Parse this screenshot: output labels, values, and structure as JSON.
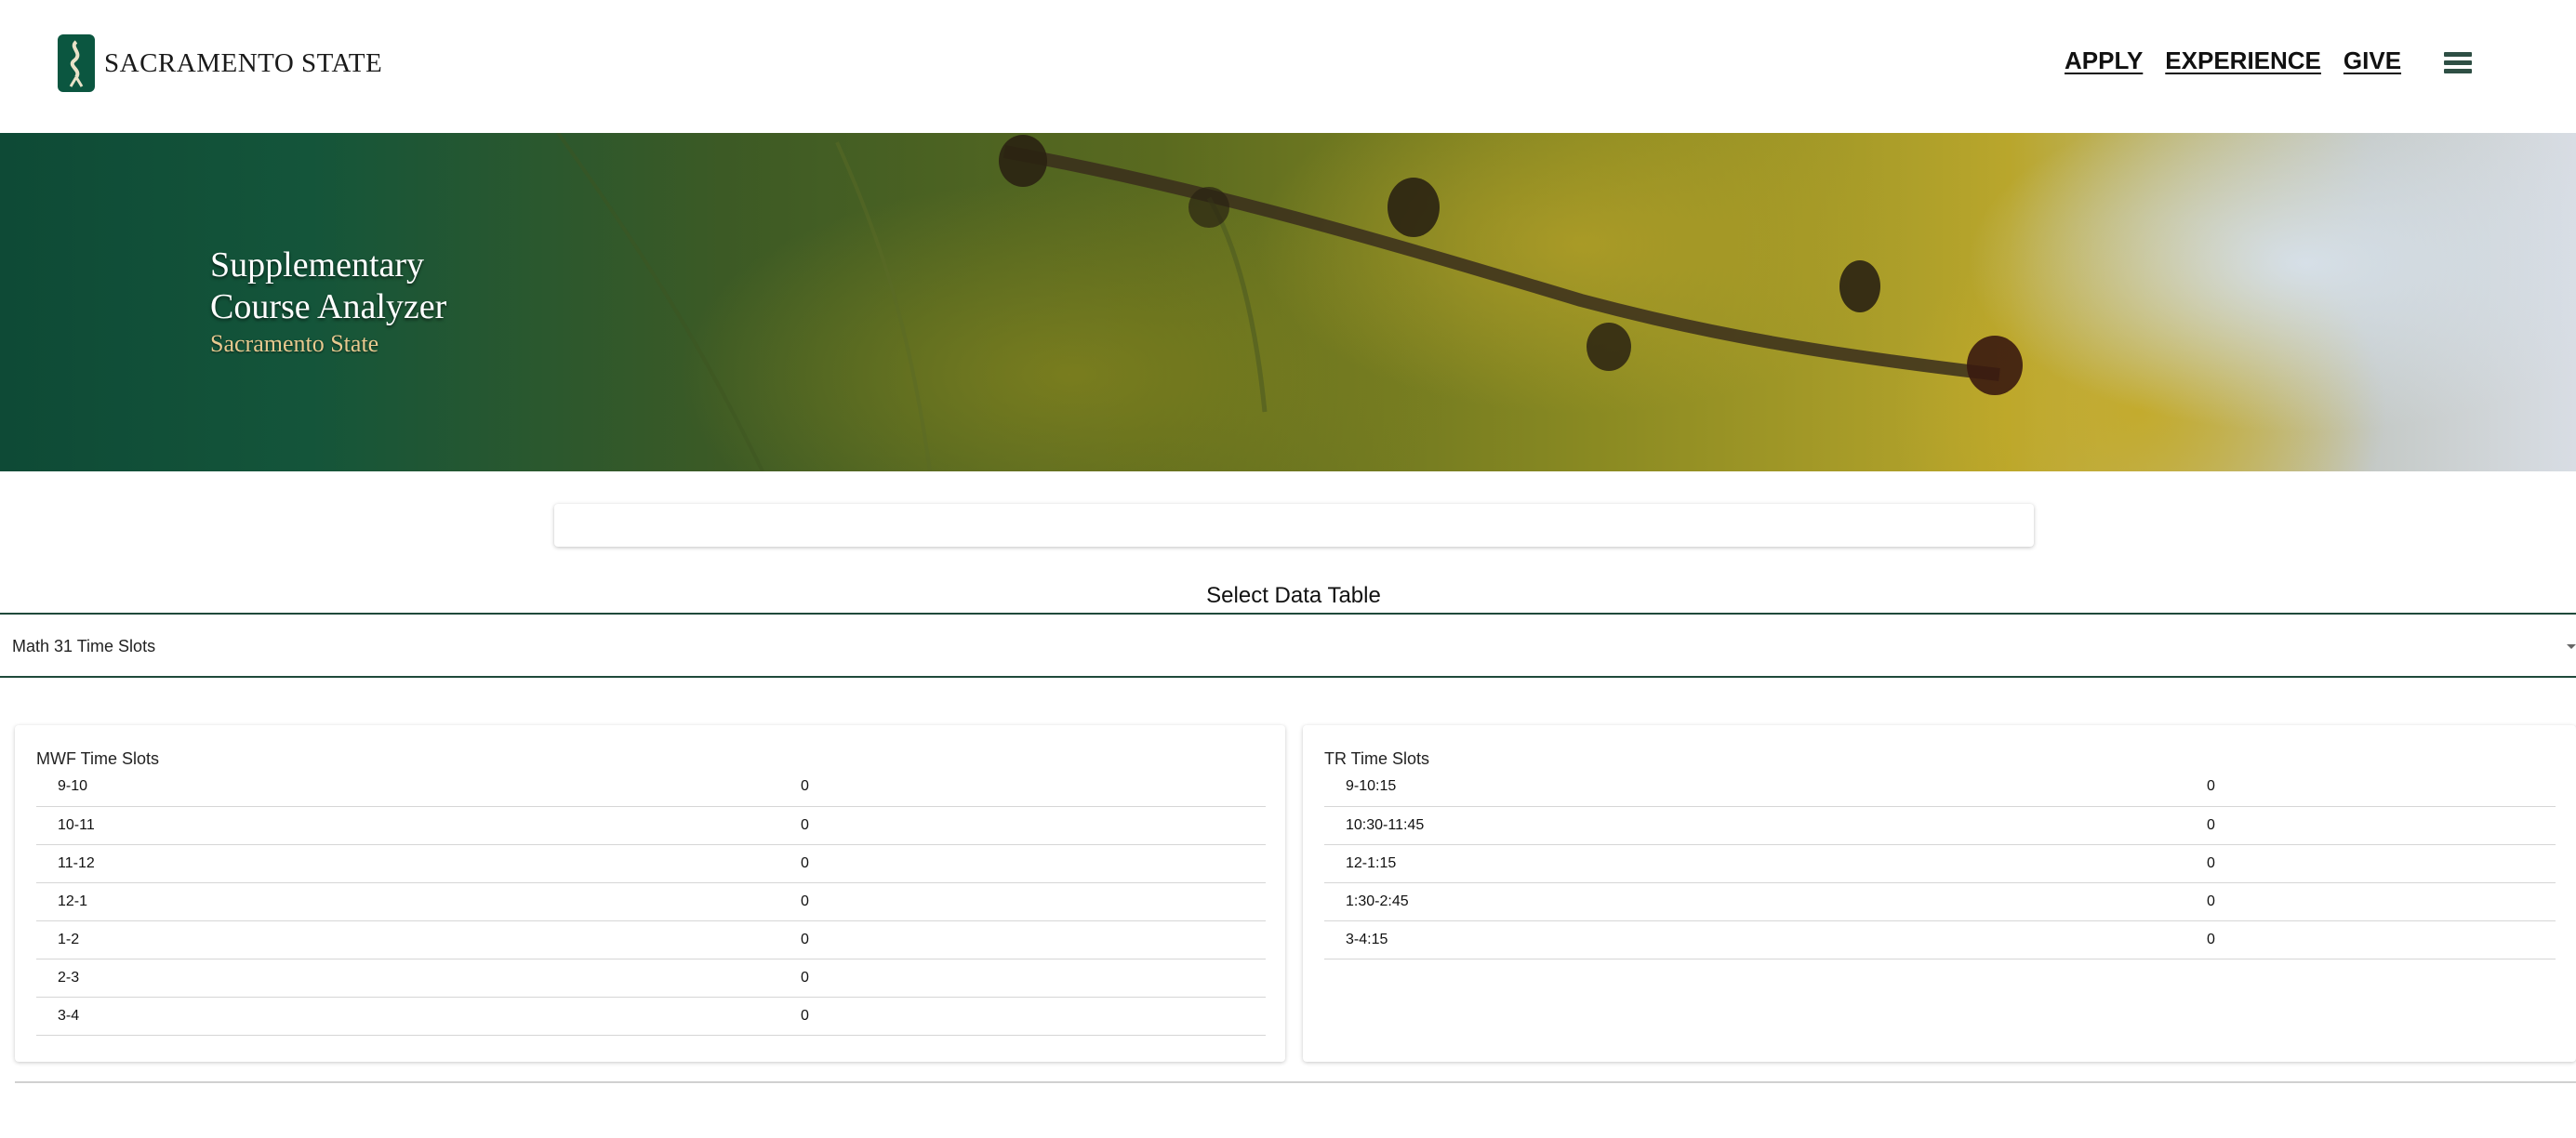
{
  "header": {
    "logo_text": "SACRAMENTO STATE",
    "nav": [
      {
        "label": "APPLY"
      },
      {
        "label": "EXPERIENCE"
      },
      {
        "label": "GIVE"
      }
    ],
    "menu_icon": "hamburger-menu-icon"
  },
  "hero": {
    "title_line1": "Supplementary",
    "title_line2": "Course Analyzer",
    "subtitle": "Sacramento State"
  },
  "selector": {
    "label": "Select Data Table",
    "selected_value": "Math 31 Time Slots"
  },
  "tables": {
    "mwf": {
      "title": "MWF Time Slots",
      "rows": [
        {
          "slot": "9-10",
          "count": "0"
        },
        {
          "slot": "10-11",
          "count": "0"
        },
        {
          "slot": "11-12",
          "count": "0"
        },
        {
          "slot": "12-1",
          "count": "0"
        },
        {
          "slot": "1-2",
          "count": "0"
        },
        {
          "slot": "2-3",
          "count": "0"
        },
        {
          "slot": "3-4",
          "count": "0"
        }
      ]
    },
    "tr": {
      "title": "TR Time Slots",
      "rows": [
        {
          "slot": "9-10:15",
          "count": "0"
        },
        {
          "slot": "10:30-11:45",
          "count": "0"
        },
        {
          "slot": "12-1:15",
          "count": "0"
        },
        {
          "slot": "1:30-2:45",
          "count": "0"
        },
        {
          "slot": "3-4:15",
          "count": "0"
        }
      ]
    }
  },
  "colors": {
    "brand_green": "#0b5640",
    "accent_gold": "#e7c98f",
    "select_border": "#1f4a3b"
  }
}
